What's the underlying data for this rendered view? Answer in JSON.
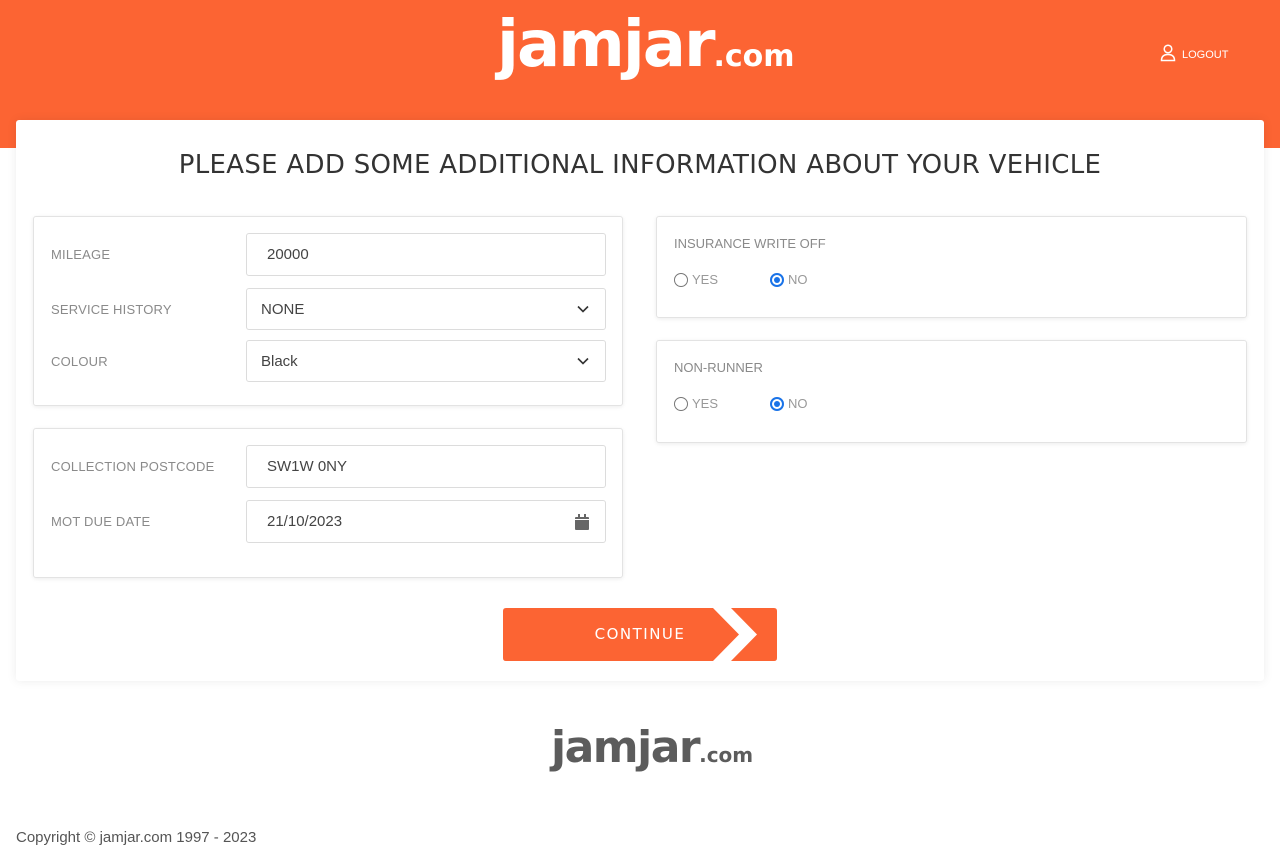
{
  "header": {
    "logo_main": "jamjar",
    "logo_suffix": ".com",
    "logout_label": "LOGOUT",
    "brand_color": "#fc6433"
  },
  "page": {
    "title": "PLEASE ADD SOME ADDITIONAL INFORMATION ABOUT YOUR VEHICLE"
  },
  "vehicle_details": {
    "mileage": {
      "label": "MILEAGE",
      "value": "20000"
    },
    "service_history": {
      "label": "SERVICE HISTORY",
      "value": "NONE"
    },
    "colour": {
      "label": "COLOUR",
      "value": "Black"
    }
  },
  "collection": {
    "postcode": {
      "label": "COLLECTION POSTCODE",
      "value": "SW1W 0NY"
    },
    "mot_due_date": {
      "label": "MOT DUE DATE",
      "value": "21/10/2023"
    }
  },
  "insurance_write_off": {
    "label": "INSURANCE WRITE OFF",
    "options": [
      {
        "label": "YES",
        "selected": false
      },
      {
        "label": "NO",
        "selected": true
      }
    ]
  },
  "non_runner": {
    "label": "NON-RUNNER",
    "options": [
      {
        "label": "YES",
        "selected": false
      },
      {
        "label": "NO",
        "selected": true
      }
    ]
  },
  "actions": {
    "continue_label": "CONTINUE"
  },
  "footer": {
    "logo_main": "jamjar",
    "logo_suffix": ".com",
    "copyright": "Copyright © jamjar.com 1997 - 2023"
  }
}
